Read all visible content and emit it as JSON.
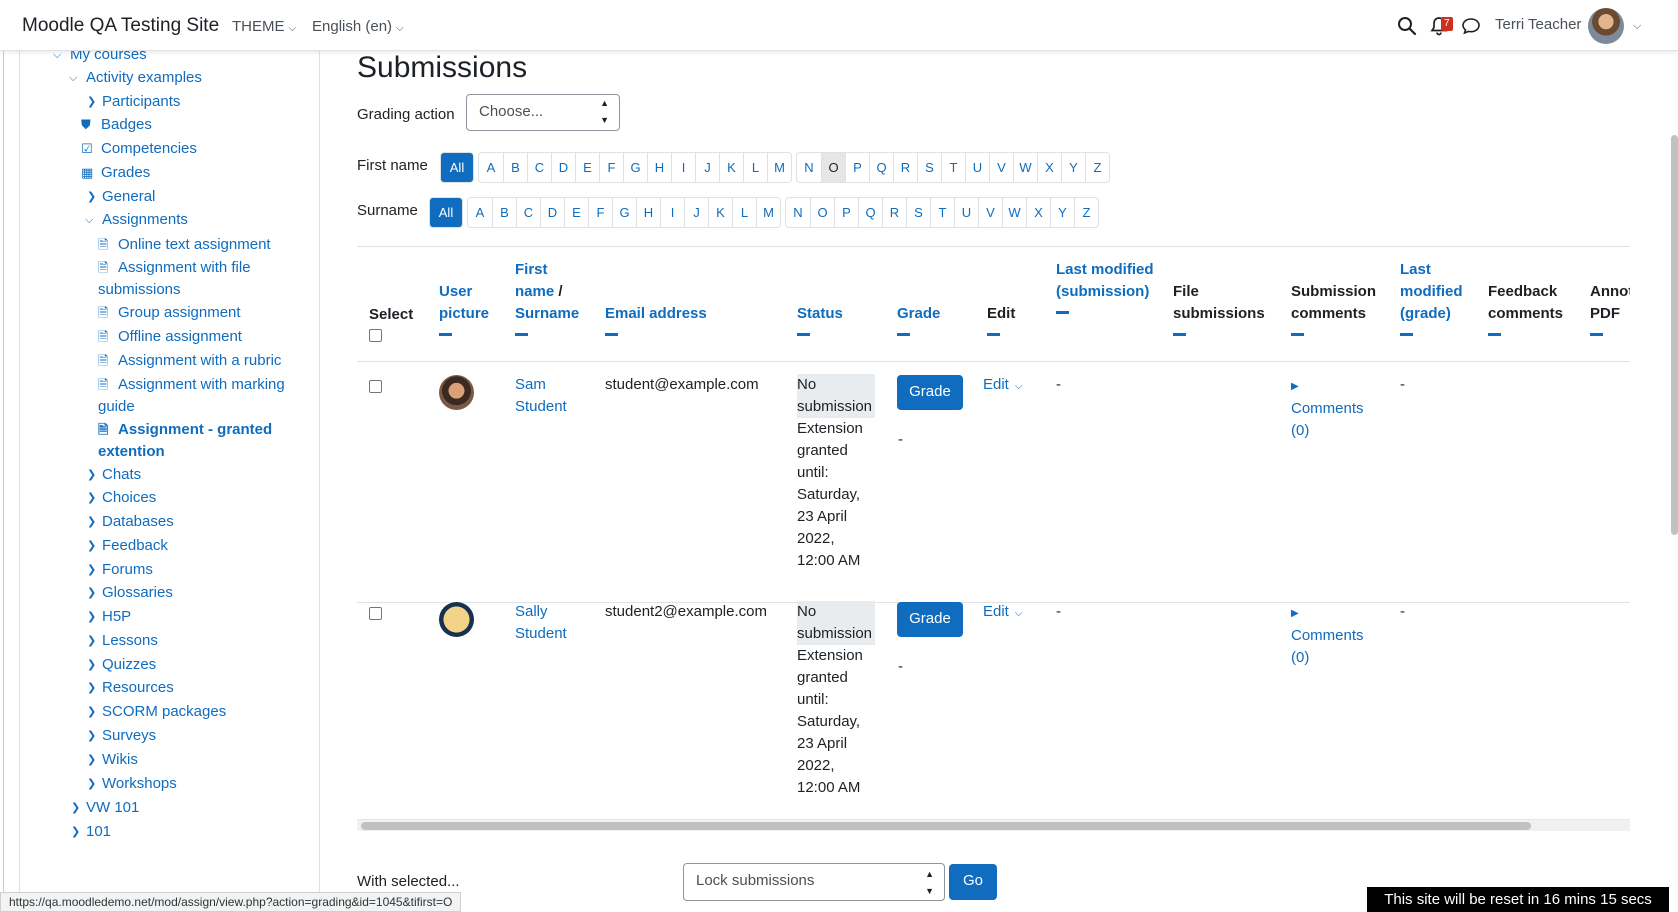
{
  "navbar": {
    "site_name": "Moodle QA Testing Site",
    "theme_menu": "THEME",
    "language_menu": "English (en)",
    "notification_count": "7",
    "user_name": "Terri Teacher"
  },
  "sidebar": {
    "my_courses": "My courses",
    "activity_examples": "Activity examples",
    "participants": "Participants",
    "badges": "Badges",
    "competencies": "Competencies",
    "grades": "Grades",
    "general": "General",
    "assignments": "Assignments",
    "assignment_items": [
      "Online text assignment",
      "Assignment with file submissions",
      "Group assignment",
      "Offline assignment",
      "Assignment with a rubric",
      "Assignment with marking guide",
      "Assignment - granted extention"
    ],
    "sections": [
      "Chats",
      "Choices",
      "Databases",
      "Feedback",
      "Forums",
      "Glossaries",
      "H5P",
      "Lessons",
      "Quizzes",
      "Resources",
      "SCORM packages",
      "Surveys",
      "Wikis",
      "Workshops"
    ],
    "other_courses": [
      "VW 101",
      "101"
    ]
  },
  "main": {
    "title": "Submissions",
    "grading_action_label": "Grading action",
    "grading_action_value": "Choose...",
    "first_name_label": "First name",
    "surname_label": "Surname",
    "all_label": "All",
    "letters_a_m": [
      "A",
      "B",
      "C",
      "D",
      "E",
      "F",
      "G",
      "H",
      "I",
      "J",
      "K",
      "L",
      "M"
    ],
    "letters_n_z": [
      "N",
      "O",
      "P",
      "Q",
      "R",
      "S",
      "T",
      "U",
      "V",
      "W",
      "X",
      "Y",
      "Z"
    ],
    "selected_first_initial": "O"
  },
  "table": {
    "headers": {
      "select": "Select",
      "user_picture": "User picture",
      "first_name": "First name",
      "name_sep": " / ",
      "surname": "Surname",
      "email": "Email address",
      "status": "Status",
      "grade": "Grade",
      "edit": "Edit",
      "last_modified_submission": "Last modified (submission)",
      "file_submissions": "File submissions",
      "submission_comments": "Submission comments",
      "last_modified_grade": "Last modified (grade)",
      "feedback_comments": "Feedback comments",
      "annotate_pdf": "Annot PDF"
    },
    "rows": [
      {
        "first": "Sam",
        "last": "Student",
        "email": "student@example.com",
        "status": "No submission",
        "extension": "Extension granted until: Saturday, 23 April 2022, 12:00 AM",
        "grade_button": "Grade",
        "grade_value": "-",
        "edit": "Edit",
        "last_modified": "-",
        "comments": "Comments (0)",
        "last_modified_grade": "-"
      },
      {
        "first": "Sally",
        "last": "Student",
        "email": "student2@example.com",
        "status": "No submission",
        "extension": "Extension granted until: Saturday, 23 April 2022, 12:00 AM",
        "grade_button": "Grade",
        "grade_value": "-",
        "edit": "Edit",
        "last_modified": "-",
        "comments": "Comments (0)",
        "last_modified_grade": "-"
      }
    ]
  },
  "footer": {
    "with_selected": "With selected...",
    "bulk_action": "Lock submissions",
    "go": "Go"
  },
  "status_url": "https://qa.moodledemo.net/mod/assign/view.php?action=grading&id=1045&tifirst=O",
  "reset_banner": "This site will be reset in 16 mins 15 secs",
  "colors": {
    "brand": "#0f6cbf",
    "notification": "#ca3120"
  }
}
